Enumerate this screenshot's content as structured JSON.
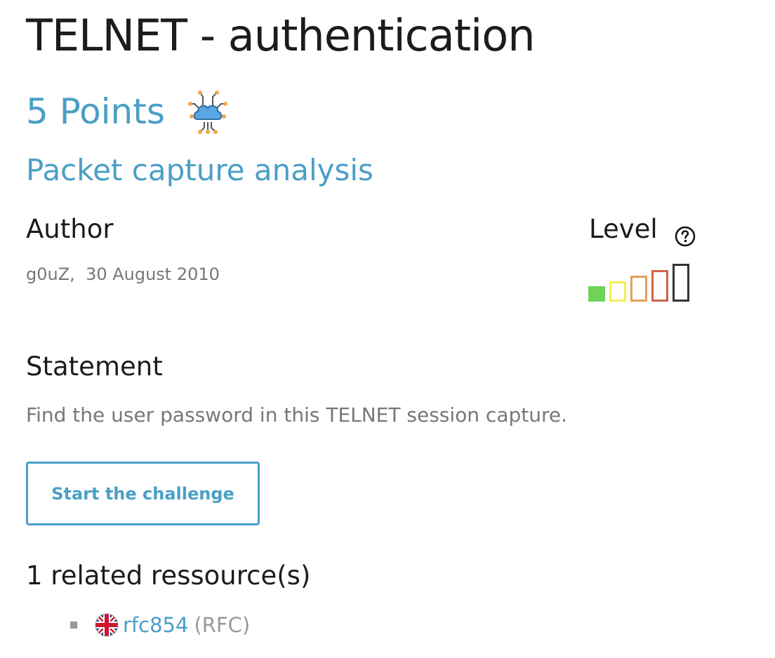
{
  "challenge": {
    "title": "TELNET - authentication",
    "points": "5 Points",
    "category_icon": "network-cloud-icon",
    "category": "Packet capture analysis"
  },
  "author": {
    "heading": "Author",
    "name": "g0uZ",
    "separator": ",",
    "date": "30 August 2010"
  },
  "level": {
    "heading": "Level",
    "help_icon": "question-circle-icon",
    "current": 1,
    "max": 5,
    "bar_colors": [
      "#6fd35a",
      "#f5ef53",
      "#e0a05a",
      "#d2634c",
      "#333333"
    ]
  },
  "statement": {
    "heading": "Statement",
    "text": "Find the user password in this TELNET session capture."
  },
  "actions": {
    "start_label": "Start the challenge"
  },
  "resources": {
    "heading": "1 related ressource(s)",
    "items": [
      {
        "flag_icon": "uk-flag-icon",
        "label": "rfc854",
        "type": "(RFC)"
      }
    ]
  }
}
